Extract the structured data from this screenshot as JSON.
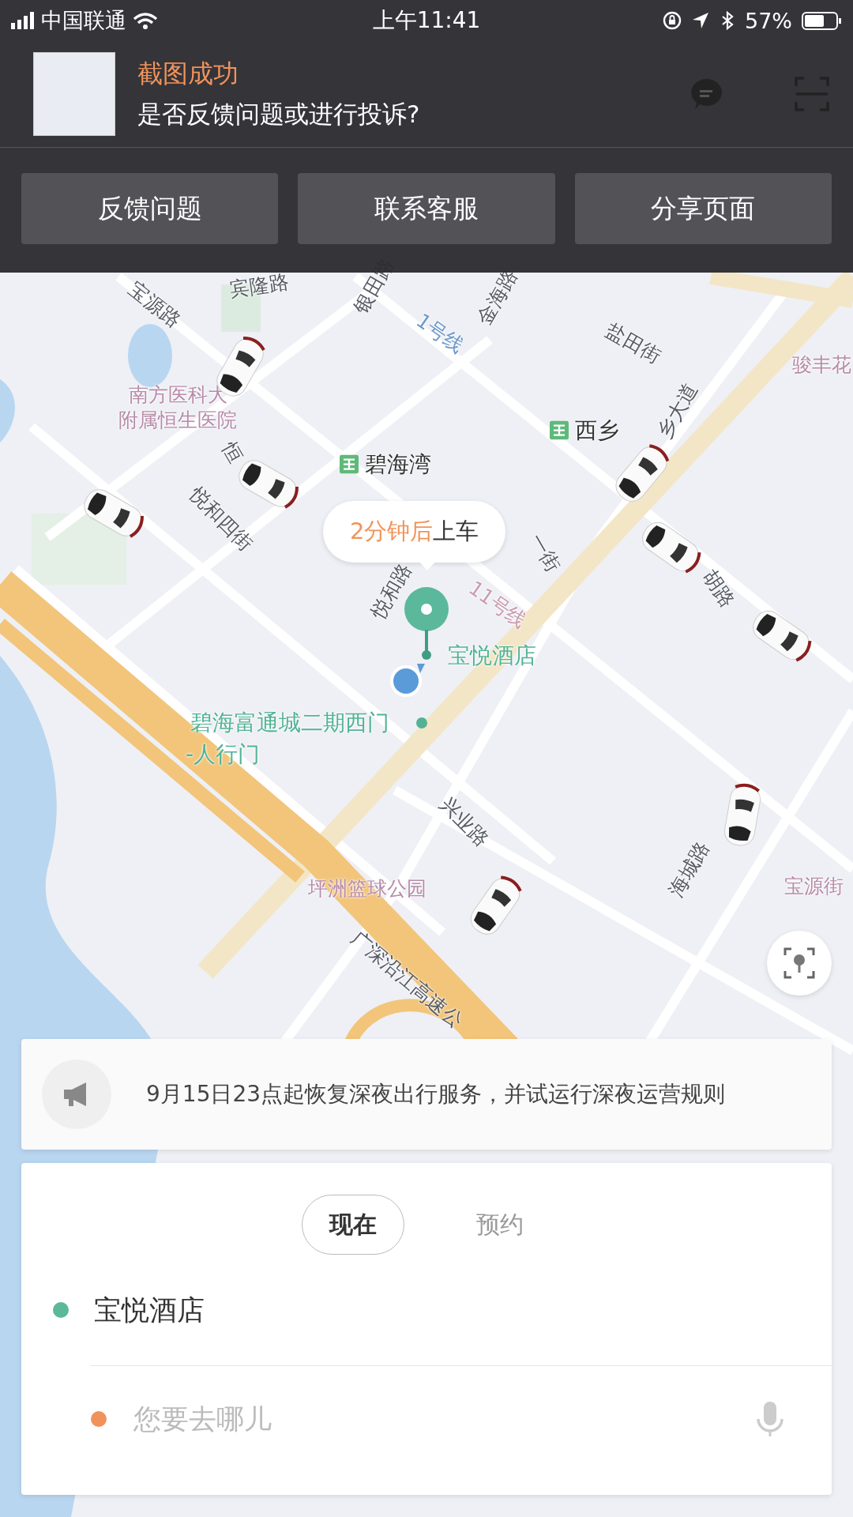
{
  "status_bar": {
    "carrier": "中国联通",
    "time": "上午11:41",
    "battery": "57%"
  },
  "notification": {
    "title": "截图成功",
    "message": "是否反馈问题或进行投诉?"
  },
  "actions": [
    "反馈问题",
    "联系客服",
    "分享页面"
  ],
  "map": {
    "labels": [
      {
        "text": "宾隆路",
        "kind": "road"
      },
      {
        "text": "宝源路",
        "kind": "road"
      },
      {
        "text": "银田路",
        "kind": "road"
      },
      {
        "text": "金海路",
        "kind": "road"
      },
      {
        "text": "1号线",
        "kind": "line",
        "color": "#6d97c9"
      },
      {
        "text": "盐田街",
        "kind": "road"
      },
      {
        "text": "骏丰花",
        "kind": "poi"
      },
      {
        "text": "南方医科大",
        "kind": "poi"
      },
      {
        "text": "附属恒生医院",
        "kind": "poi"
      },
      {
        "text": "西乡",
        "kind": "station"
      },
      {
        "text": "碧海湾",
        "kind": "station"
      },
      {
        "text": "乡大道",
        "kind": "road"
      },
      {
        "text": "恒",
        "kind": "road"
      },
      {
        "text": "悦和四街",
        "kind": "road"
      },
      {
        "text": "一街",
        "kind": "road"
      },
      {
        "text": "胡路",
        "kind": "road"
      },
      {
        "text": "悦和路",
        "kind": "road"
      },
      {
        "text": "11号线",
        "kind": "line",
        "color": "#c99aae"
      },
      {
        "text": "宝悦酒店",
        "kind": "spot"
      },
      {
        "text": "碧海富通城二期西门",
        "kind": "spot"
      },
      {
        "text": "-人行门",
        "kind": "spot"
      },
      {
        "text": "兴业路",
        "kind": "road"
      },
      {
        "text": "海城路",
        "kind": "road"
      },
      {
        "text": "宝源街",
        "kind": "poi"
      },
      {
        "text": "坪洲篮球公园",
        "kind": "poi"
      },
      {
        "text": "广深沿江高速公",
        "kind": "road"
      }
    ],
    "callout": {
      "eta": "2分钟后",
      "action": "上车"
    }
  },
  "notice": {
    "text": "9月15日23点起恢复深夜出行服务，并试运行深夜运营规则"
  },
  "booking": {
    "modes": [
      {
        "label": "现在",
        "selected": true
      },
      {
        "label": "预约",
        "selected": false
      }
    ],
    "stops": [
      {
        "kind": "pickup",
        "value": "宝悦酒店",
        "color": "#5bb89b"
      },
      {
        "kind": "destination",
        "placeholder": "您要去哪儿",
        "color": "#f0935a"
      }
    ]
  }
}
